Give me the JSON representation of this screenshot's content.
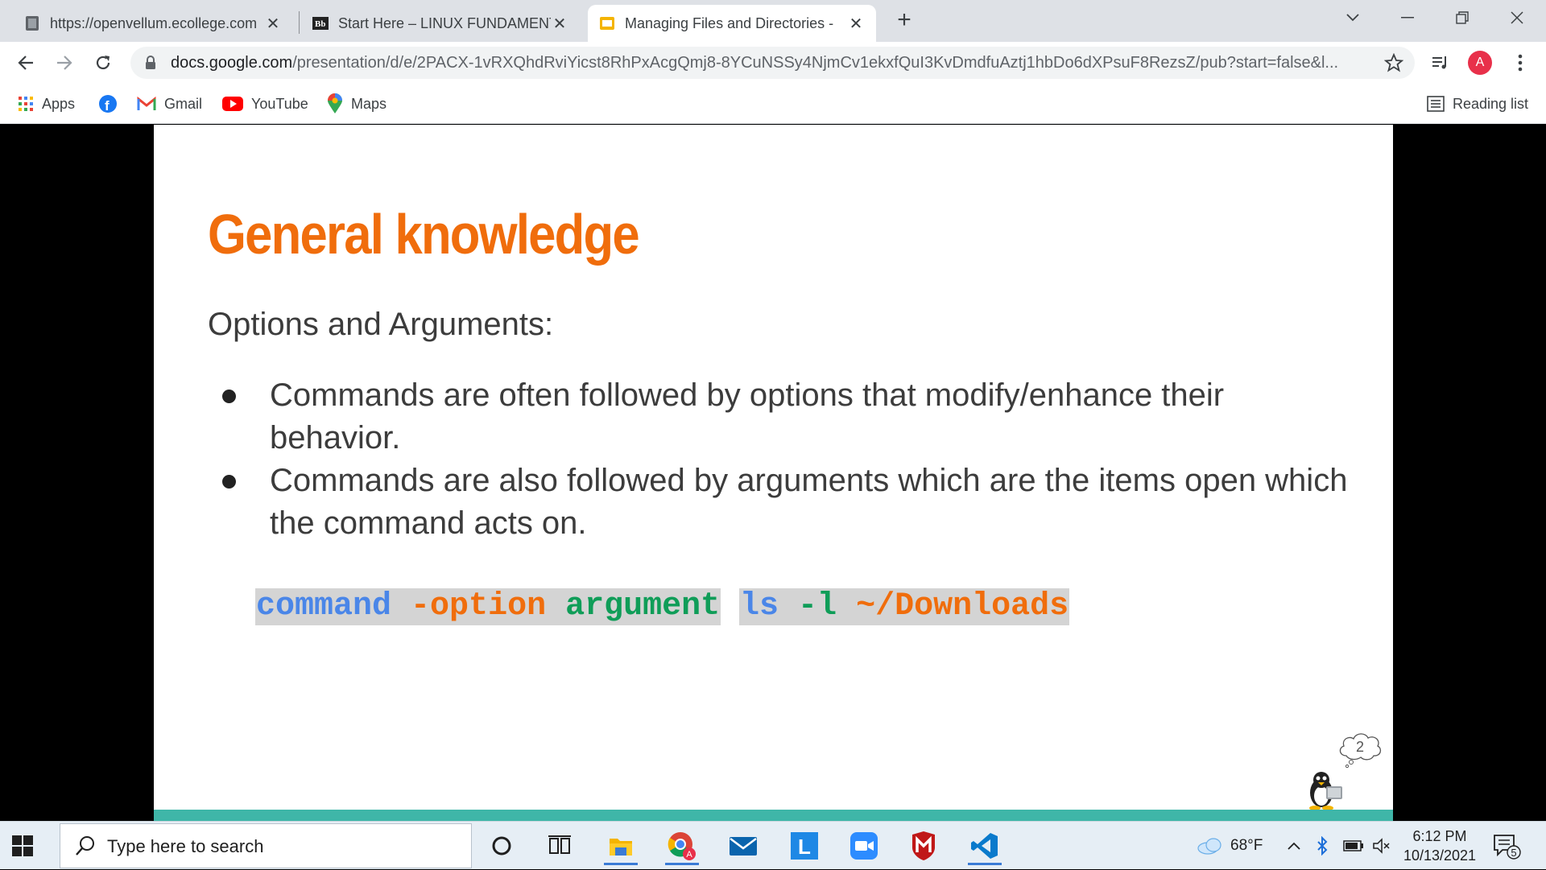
{
  "browser": {
    "tabs": [
      {
        "title": "https://openvellum.ecollege.com",
        "favicon": "page-icon",
        "active": false
      },
      {
        "title": "Start Here – LINUX FUNDAMENTALS",
        "favicon": "blackboard-icon",
        "active": false
      },
      {
        "title": "Managing Files and Directories -",
        "favicon": "slides-icon",
        "active": true
      }
    ],
    "url_domain": "docs.google.com",
    "url_path": "/presentation/d/e/2PACX-1vRXQhdRviYicst8RhPxAcgQmj8-8YCuNSSy4NjmCv1ekxfQuI3KvDmdfuAztj1hbDo6dXPsuF8RezsZ/pub?start=false&l...",
    "profile_initial": "A",
    "bookmarks": [
      {
        "label": "Apps",
        "icon": "apps-grid-icon"
      },
      {
        "label": "",
        "icon": "facebook-icon"
      },
      {
        "label": "Gmail",
        "icon": "gmail-icon"
      },
      {
        "label": "YouTube",
        "icon": "youtube-icon"
      },
      {
        "label": "Maps",
        "icon": "maps-icon"
      }
    ],
    "reading_list": "Reading list"
  },
  "slide": {
    "title": "General knowledge",
    "subtitle": "Options and Arguments:",
    "bullets": [
      "Commands are often followed by options that modify/enhance their behavior.",
      "Commands are also followed by arguments which are the items open which the command acts on."
    ],
    "code_template": {
      "command": "command",
      "option": "-option",
      "argument": "argument"
    },
    "code_example": {
      "command": "ls",
      "option": "-l",
      "argument": "~/Downloads"
    },
    "page_number": "2",
    "colors": {
      "title": "#f06d0c",
      "command": "#4a86e8",
      "option": "#f06d0c",
      "argument": "#0f9d58",
      "accent_bar": "#3fb6a8"
    }
  },
  "taskbar": {
    "search_placeholder": "Type here to search",
    "apps": [
      "cortana-icon",
      "task-view-icon",
      "file-explorer-icon",
      "chrome-icon",
      "mail-icon",
      "l-app-icon",
      "zoom-icon",
      "mcafee-icon",
      "vscode-icon"
    ],
    "weather": "68°F",
    "time": "6:12 PM",
    "date": "10/13/2021",
    "notification_count": "5"
  }
}
